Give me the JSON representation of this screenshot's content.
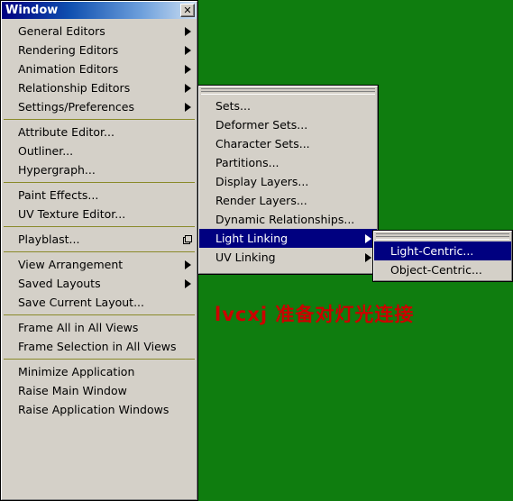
{
  "desktop": {
    "background_color": "#0f7d0f",
    "overlay_text": "lvcxj  准备对灯光连接"
  },
  "window_menu": {
    "title": "Window",
    "close_label": "✕",
    "groups": [
      {
        "items": [
          {
            "label": "General Editors",
            "submenu": true
          },
          {
            "label": "Rendering Editors",
            "submenu": true
          },
          {
            "label": "Animation Editors",
            "submenu": true
          },
          {
            "label": "Relationship Editors",
            "submenu": true
          },
          {
            "label": "Settings/Preferences",
            "submenu": true
          }
        ]
      },
      {
        "items": [
          {
            "label": "Attribute Editor...",
            "submenu": false
          },
          {
            "label": "Outliner...",
            "submenu": false
          },
          {
            "label": "Hypergraph...",
            "submenu": false
          }
        ]
      },
      {
        "items": [
          {
            "label": "Paint Effects...",
            "submenu": false
          },
          {
            "label": "UV Texture Editor...",
            "submenu": false
          }
        ]
      },
      {
        "items": [
          {
            "label": "Playblast...",
            "submenu": false,
            "option_box": true
          }
        ]
      },
      {
        "items": [
          {
            "label": "View Arrangement",
            "submenu": true
          },
          {
            "label": "Saved Layouts",
            "submenu": true
          },
          {
            "label": "Save Current Layout...",
            "submenu": false
          }
        ]
      },
      {
        "items": [
          {
            "label": "Frame All in All Views",
            "submenu": false
          },
          {
            "label": "Frame Selection in All Views",
            "submenu": false
          }
        ]
      },
      {
        "items": [
          {
            "label": "Minimize Application",
            "submenu": false
          },
          {
            "label": "Raise Main Window",
            "submenu": false
          },
          {
            "label": "Raise Application Windows",
            "submenu": false
          }
        ]
      }
    ]
  },
  "relationship_editors_submenu": {
    "items": [
      {
        "label": "Sets...",
        "submenu": false,
        "highlighted": false
      },
      {
        "label": "Deformer Sets...",
        "submenu": false,
        "highlighted": false
      },
      {
        "label": "Character Sets...",
        "submenu": false,
        "highlighted": false
      },
      {
        "label": "Partitions...",
        "submenu": false,
        "highlighted": false
      },
      {
        "label": "Display Layers...",
        "submenu": false,
        "highlighted": false
      },
      {
        "label": "Render Layers...",
        "submenu": false,
        "highlighted": false
      },
      {
        "label": "Dynamic Relationships...",
        "submenu": false,
        "highlighted": false
      },
      {
        "label": "Light Linking",
        "submenu": true,
        "highlighted": true
      },
      {
        "label": "UV Linking",
        "submenu": true,
        "highlighted": false
      }
    ]
  },
  "light_linking_submenu": {
    "items": [
      {
        "label": "Light-Centric...",
        "submenu": false,
        "highlighted": true
      },
      {
        "label": "Object-Centric...",
        "submenu": false,
        "highlighted": false
      }
    ]
  },
  "colors": {
    "menu_face": "#d4d0c8",
    "highlight": "#000080",
    "separator": "#8a8a2a",
    "desktop_green": "#0f7d0f",
    "overlay_red": "#cc0000"
  }
}
